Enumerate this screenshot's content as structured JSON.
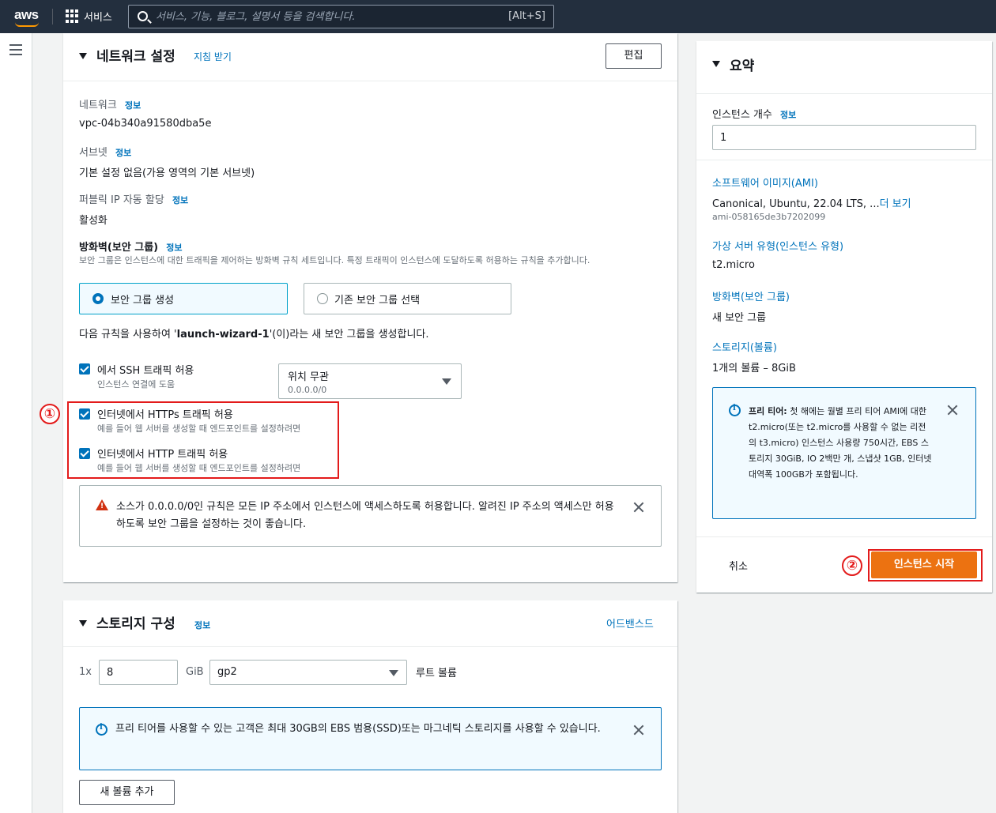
{
  "topbar": {
    "logo": "aws",
    "services_label": "서비스",
    "search_placeholder": "서비스, 기능, 블로그, 설명서 등을 검색합니다.",
    "search_shortcut": "[Alt+S]"
  },
  "network": {
    "title": "네트워크 설정",
    "guide_link": "지침 받기",
    "edit_button": "편집",
    "network_label": "네트워크",
    "network_info": "정보",
    "network_value": "vpc-04b340a91580dba5e",
    "subnet_label": "서브넷",
    "subnet_info": "정보",
    "subnet_value": "기본 설정 없음(가용 영역의 기본 서브넷)",
    "public_ip_label": "퍼블릭 IP 자동 할당",
    "public_ip_info": "정보",
    "public_ip_value": "활성화",
    "firewall_label": "방화벽(보안 그룹)",
    "firewall_info": "정보",
    "firewall_desc": "보안 그룹은 인스턴스에 대한 트래픽을 제어하는 방화벽 규칙 세트입니다. 특정 트래픽이 인스턴스에 도달하도록 허용하는 규칙을 추가합니다.",
    "option_create": "보안 그룹 생성",
    "option_existing": "기존 보안 그룹 선택",
    "rule_sentence_prefix": "다음 규칙을 사용하여 '",
    "rule_sentence_name": "launch-wizard-1",
    "rule_sentence_suffix": "'(이)라는 새 보안 그룹을 생성합니다.",
    "ssh_label": "에서 SSH 트래픽 허용",
    "ssh_hint": "인스턴스 연결에 도움",
    "ssh_source_value": "위치 무관",
    "ssh_source_sub": "0.0.0.0/0",
    "https_label": "인터넷에서 HTTPs 트래픽 허용",
    "https_hint": "예를 들어 웹 서버를 생성할 때 엔드포인트를 설정하려면",
    "http_label": "인터넷에서 HTTP 트래픽 허용",
    "http_hint": "예를 들어 웹 서버를 생성할 때 엔드포인트를 설정하려면",
    "warning_text": "소스가 0.0.0.0/0인 규칙은 모든 IP 주소에서 인스턴스에 액세스하도록 허용합니다. 알려진 IP 주소의 액세스만 허용하도록 보안 그룹을 설정하는 것이 좋습니다."
  },
  "storage": {
    "title": "스토리지 구성",
    "info": "정보",
    "advanced_link": "어드밴스드",
    "multiplier": "1x",
    "size_value": "8",
    "unit": "GiB",
    "volume_type": "gp2",
    "root_label": "루트 볼륨",
    "free_tier_text": "프리 티어를 사용할 수 있는 고객은 최대 30GB의 EBS 범용(SSD)또는 마그네틱 스토리지를 사용할 수 있습니다.",
    "add_volume_button": "새 볼륨 추가"
  },
  "summary": {
    "title": "요약",
    "instance_count_label": "인스턴스 개수",
    "instance_count_info": "정보",
    "instance_count_value": "1",
    "ami_link": "소프트웨어 이미지(AMI)",
    "ami_value": "Canonical, Ubuntu, 22.04 LTS, ...",
    "ami_more": "더 보기",
    "ami_id": "ami-058165de3b7202099",
    "instance_type_link": "가상 서버 유형(인스턴스 유형)",
    "instance_type_value": "t2.micro",
    "firewall_link": "방화벽(보안 그룹)",
    "firewall_value": "새 보안 그룹",
    "storage_link": "스토리지(볼륨)",
    "storage_value": "1개의 볼륨 – 8GiB",
    "free_tier_bold": "프리 티어:",
    "free_tier_text": "첫 해에는 월별 프리 티어 AMI에 대한 t2.micro(또는 t2.micro를 사용할 수 없는 리전의 t3.micro) 인스턴스 사용량 750시간, EBS 스토리지 30GiB, IO 2백만 개, 스냅샷 1GB, 인터넷 대역폭 100GB가 포함됩니다.",
    "cancel_button": "취소",
    "launch_button": "인스턴스 시작"
  },
  "annotations": {
    "marker_1": "①",
    "marker_2": "②"
  },
  "colors": {
    "topbar": "#232f3e",
    "accent_blue": "#0073bb",
    "launch_orange": "#ec7211",
    "annotation_red": "#e31b1b"
  }
}
